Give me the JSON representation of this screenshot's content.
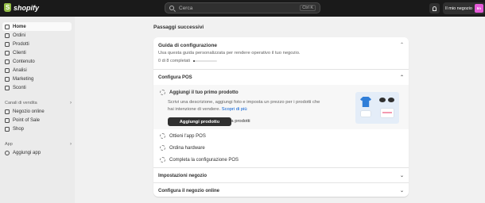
{
  "topbar": {
    "brand": "shopify",
    "search_placeholder": "Cerca",
    "search_shortcut": "Ctrl K",
    "store_name": "Il mio negozio",
    "avatar_initials": "Im"
  },
  "sidebar": {
    "items": [
      {
        "label": "Home",
        "icon": "home-icon"
      },
      {
        "label": "Ordini",
        "icon": "orders-icon"
      },
      {
        "label": "Prodotti",
        "icon": "tag-icon"
      },
      {
        "label": "Clienti",
        "icon": "person-icon"
      },
      {
        "label": "Contenuto",
        "icon": "content-icon"
      },
      {
        "label": "Analisi",
        "icon": "analytics-icon"
      },
      {
        "label": "Marketing",
        "icon": "target-icon"
      },
      {
        "label": "Sconti",
        "icon": "discount-icon"
      }
    ],
    "sales_channels_label": "Canali di vendita",
    "channels": [
      {
        "label": "Negozio online",
        "icon": "store-icon"
      },
      {
        "label": "Point of Sale",
        "icon": "pos-icon"
      },
      {
        "label": "Shop",
        "icon": "shop-icon"
      }
    ],
    "apps_label": "App",
    "add_app_label": "Aggiungi app"
  },
  "main": {
    "title": "Passaggi successivi",
    "guide": {
      "title": "Guida di configurazione",
      "description": "Usa questa guida personalizzata per rendere operativo il tuo negozio.",
      "progress_text": "0 di 8 completati",
      "progress_fraction": 0
    },
    "sections": {
      "pos": "Configura POS",
      "store_settings": "Impostazioni negozio",
      "online_store": "Configura il negozio online"
    },
    "tasks": {
      "first_product_title": "Aggiungi il tuo primo prodotto",
      "first_product_desc": "Scrivi una descrizione, aggiungi foto e imposta un prezzo per i prodotti che hai intenzione di vendere.",
      "learn_more": "Scopri di più",
      "add_product_button": "Aggiungi prodotto",
      "import_products_button": "Importa prodotti",
      "get_pos_app": "Ottieni l'app POS",
      "order_hardware": "Ordina hardware",
      "complete_pos_setup": "Completa la configurazione POS"
    }
  },
  "colors": {
    "topbar_bg": "#1a1a1a",
    "brand_green": "#95bf47",
    "primary_button": "#303030",
    "link": "#005bd3",
    "avatar": "#e55bd8"
  }
}
